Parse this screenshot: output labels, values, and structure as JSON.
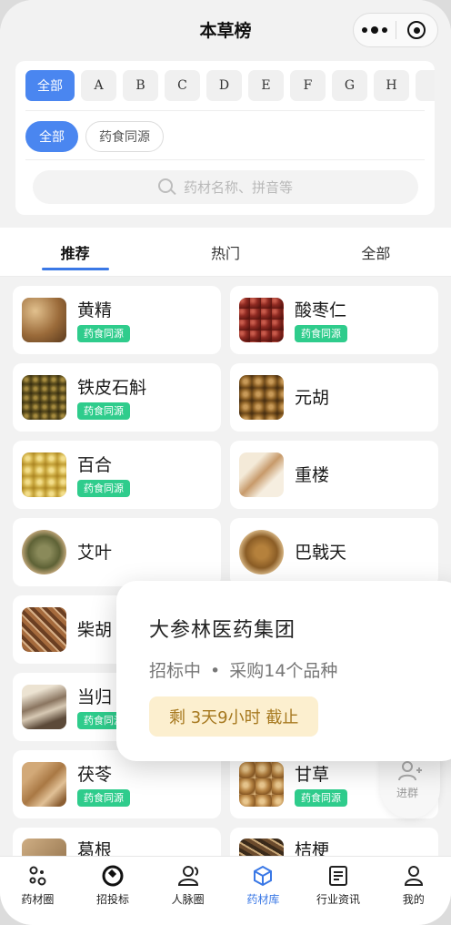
{
  "navbar": {
    "title": "本草榜"
  },
  "filters": {
    "letters": [
      "全部",
      "A",
      "B",
      "C",
      "D",
      "E",
      "F",
      "G",
      "H",
      ""
    ],
    "categories": [
      "全部",
      "药食同源"
    ],
    "search_placeholder": "药材名称、拼音等"
  },
  "tabs": [
    "推荐",
    "热门",
    "全部"
  ],
  "herbs": [
    {
      "name": "黄精",
      "badge": "药食同源"
    },
    {
      "name": "酸枣仁",
      "badge": "药食同源"
    },
    {
      "name": "铁皮石斛",
      "badge": "药食同源"
    },
    {
      "name": "元胡",
      "badge": ""
    },
    {
      "name": "百合",
      "badge": "药食同源"
    },
    {
      "name": "重楼",
      "badge": ""
    },
    {
      "name": "艾叶",
      "badge": ""
    },
    {
      "name": "巴戟天",
      "badge": ""
    },
    {
      "name": "柴胡",
      "badge": ""
    },
    {
      "name": "",
      "badge": ""
    },
    {
      "name": "当归",
      "badge": "药食同源"
    },
    {
      "name": "",
      "badge": ""
    },
    {
      "name": "茯苓",
      "badge": "药食同源"
    },
    {
      "name": "甘草",
      "badge": "药食同源"
    },
    {
      "name": "葛根",
      "badge": ""
    },
    {
      "name": "桔梗",
      "badge": ""
    }
  ],
  "popup": {
    "company": "大参林医药集团",
    "status": "招标中",
    "detail": "采购14个品种",
    "deadline": "剩 3天9小时 截止"
  },
  "float_button": {
    "label": "进群"
  },
  "tabbar": [
    {
      "label": "药材圈",
      "icon": "circle-dots-icon"
    },
    {
      "label": "招投标",
      "icon": "bid-icon"
    },
    {
      "label": "人脉圈",
      "icon": "people-icon"
    },
    {
      "label": "药材库",
      "icon": "cube-icon"
    },
    {
      "label": "行业资讯",
      "icon": "news-icon"
    },
    {
      "label": "我的",
      "icon": "profile-icon"
    }
  ],
  "colors": {
    "accent": "#4a86f0",
    "badge": "#2fcc8c",
    "deadline_bg": "#fcefcf",
    "deadline_text": "#a6781e"
  }
}
